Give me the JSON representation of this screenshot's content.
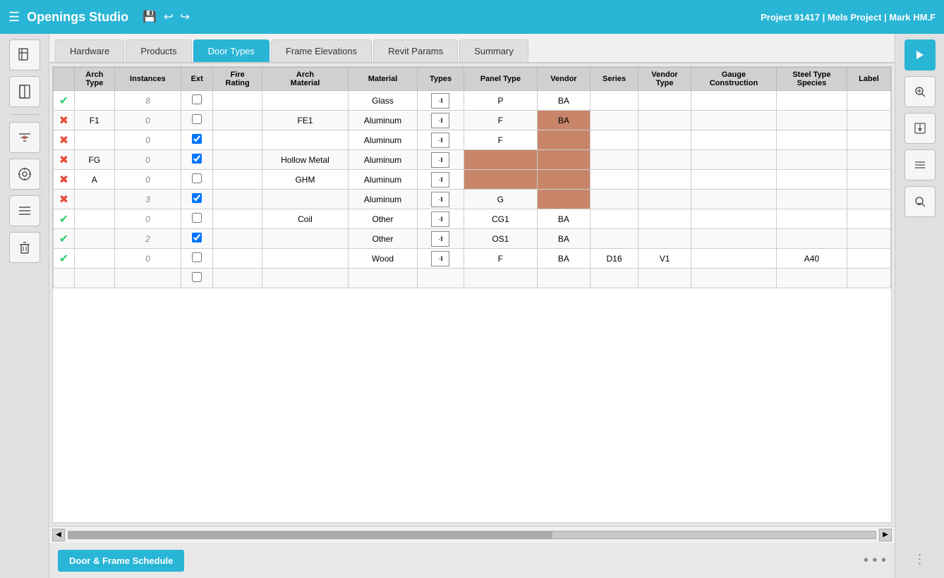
{
  "header": {
    "app_title": "Openings Studio",
    "project_info": "Project 91417 | Mels Project | Mark HM.F"
  },
  "tabs": [
    {
      "id": "hardware",
      "label": "Hardware",
      "active": false
    },
    {
      "id": "products",
      "label": "Products",
      "active": false
    },
    {
      "id": "door_types",
      "label": "Door Types",
      "active": true
    },
    {
      "id": "frame_elevations",
      "label": "Frame Elevations",
      "active": false
    },
    {
      "id": "revit_params",
      "label": "Revit Params",
      "active": false
    },
    {
      "id": "summary",
      "label": "Summary",
      "active": false
    }
  ],
  "table": {
    "columns": [
      {
        "id": "status",
        "label": ""
      },
      {
        "id": "arch_type",
        "label": "Arch Type"
      },
      {
        "id": "instances",
        "label": "Instances"
      },
      {
        "id": "ext",
        "label": "Ext"
      },
      {
        "id": "fire_rating",
        "label": "Fire Rating"
      },
      {
        "id": "arch_material",
        "label": "Arch Material"
      },
      {
        "id": "material",
        "label": "Material"
      },
      {
        "id": "types",
        "label": "Types"
      },
      {
        "id": "panel_type",
        "label": "Panel Type"
      },
      {
        "id": "vendor",
        "label": "Vendor"
      },
      {
        "id": "series",
        "label": "Series"
      },
      {
        "id": "vendor_type",
        "label": "Vendor Type"
      },
      {
        "id": "gauge_construction",
        "label": "Gauge Construction"
      },
      {
        "id": "steel_type_species",
        "label": "Steel Type Species"
      },
      {
        "id": "label",
        "label": "Label"
      }
    ],
    "rows": [
      {
        "status": "ok",
        "arch_type": "",
        "instances": "8",
        "ext": false,
        "fire_rating": "",
        "arch_material": "",
        "material": "Glass",
        "types": "panel",
        "panel_type": "P",
        "vendor": "BA",
        "series": "",
        "vendor_type": "",
        "gauge_construction": "",
        "steel_type_species": "",
        "label": "",
        "highlight_vendor": false
      },
      {
        "status": "err",
        "arch_type": "F1",
        "instances": "0",
        "ext": false,
        "fire_rating": "",
        "arch_material": "FE1",
        "material": "Aluminum",
        "types": "panel",
        "panel_type": "F",
        "vendor": "BA",
        "series": "",
        "vendor_type": "",
        "gauge_construction": "",
        "steel_type_species": "",
        "label": "",
        "highlight_vendor": true
      },
      {
        "status": "err",
        "arch_type": "",
        "instances": "0",
        "ext": true,
        "fire_rating": "",
        "arch_material": "",
        "material": "Aluminum",
        "types": "panel",
        "panel_type": "F",
        "vendor": "",
        "series": "",
        "vendor_type": "",
        "gauge_construction": "",
        "steel_type_species": "",
        "label": "",
        "highlight_vendor": true
      },
      {
        "status": "err",
        "arch_type": "FG",
        "instances": "0",
        "ext": true,
        "fire_rating": "",
        "arch_material": "Hollow Metal",
        "material": "Aluminum",
        "types": "panel",
        "panel_type": "",
        "vendor": "",
        "series": "",
        "vendor_type": "",
        "gauge_construction": "",
        "steel_type_species": "",
        "label": "",
        "highlight_vendor": true
      },
      {
        "status": "err",
        "arch_type": "A",
        "instances": "0",
        "ext": false,
        "fire_rating": "",
        "arch_material": "GHM",
        "material": "Aluminum",
        "types": "panel",
        "panel_type": "",
        "vendor": "",
        "series": "",
        "vendor_type": "",
        "gauge_construction": "",
        "steel_type_species": "",
        "label": "",
        "highlight_vendor": true
      },
      {
        "status": "err",
        "arch_type": "",
        "instances": "3",
        "ext": true,
        "fire_rating": "",
        "arch_material": "",
        "material": "Aluminum",
        "types": "panel",
        "panel_type": "G",
        "vendor": "",
        "series": "",
        "vendor_type": "",
        "gauge_construction": "",
        "steel_type_species": "",
        "label": "",
        "highlight_vendor": true
      },
      {
        "status": "ok",
        "arch_type": "",
        "instances": "0",
        "ext": false,
        "fire_rating": "",
        "arch_material": "Coil",
        "material": "Other",
        "types": "panel",
        "panel_type": "CG1",
        "vendor": "BA",
        "series": "",
        "vendor_type": "",
        "gauge_construction": "",
        "steel_type_species": "",
        "label": "",
        "highlight_vendor": false
      },
      {
        "status": "ok",
        "arch_type": "",
        "instances": "2",
        "ext": true,
        "fire_rating": "",
        "arch_material": "",
        "material": "Other",
        "types": "panel",
        "panel_type": "OS1",
        "vendor": "BA",
        "series": "",
        "vendor_type": "",
        "gauge_construction": "",
        "steel_type_species": "",
        "label": "",
        "highlight_vendor": false
      },
      {
        "status": "ok",
        "arch_type": "",
        "instances": "0",
        "ext": false,
        "fire_rating": "",
        "arch_material": "",
        "material": "Wood",
        "types": "panel",
        "panel_type": "F",
        "vendor": "BA",
        "series": "D16",
        "vendor_type": "V1",
        "gauge_construction": "",
        "steel_type_species": "A40",
        "label": "",
        "highlight_vendor": false
      },
      {
        "status": "empty",
        "arch_type": "",
        "instances": "",
        "ext": false,
        "fire_rating": "",
        "arch_material": "",
        "material": "",
        "types": "",
        "panel_type": "",
        "vendor": "",
        "series": "",
        "vendor_type": "",
        "gauge_construction": "",
        "steel_type_species": "",
        "label": "",
        "highlight_vendor": false
      }
    ]
  },
  "footer": {
    "schedule_button": "Door & Frame Schedule"
  },
  "sidebar_left": {
    "buttons": [
      {
        "icon": "📄",
        "name": "new-document"
      },
      {
        "icon": "🚪",
        "name": "door-icon"
      },
      {
        "icon": "≡⊘",
        "name": "filter-icon"
      },
      {
        "icon": "🎯",
        "name": "target-icon"
      },
      {
        "icon": "☰",
        "name": "list-icon"
      },
      {
        "icon": "🗑",
        "name": "delete-icon"
      }
    ]
  },
  "sidebar_right": {
    "buttons": [
      {
        "icon": "▶",
        "name": "arrow-icon",
        "active": true
      },
      {
        "icon": "⊕",
        "name": "zoom-icon"
      },
      {
        "icon": "↩",
        "name": "import-icon"
      },
      {
        "icon": "≡",
        "name": "list-icon"
      },
      {
        "icon": "🔍",
        "name": "search-icon"
      }
    ]
  }
}
